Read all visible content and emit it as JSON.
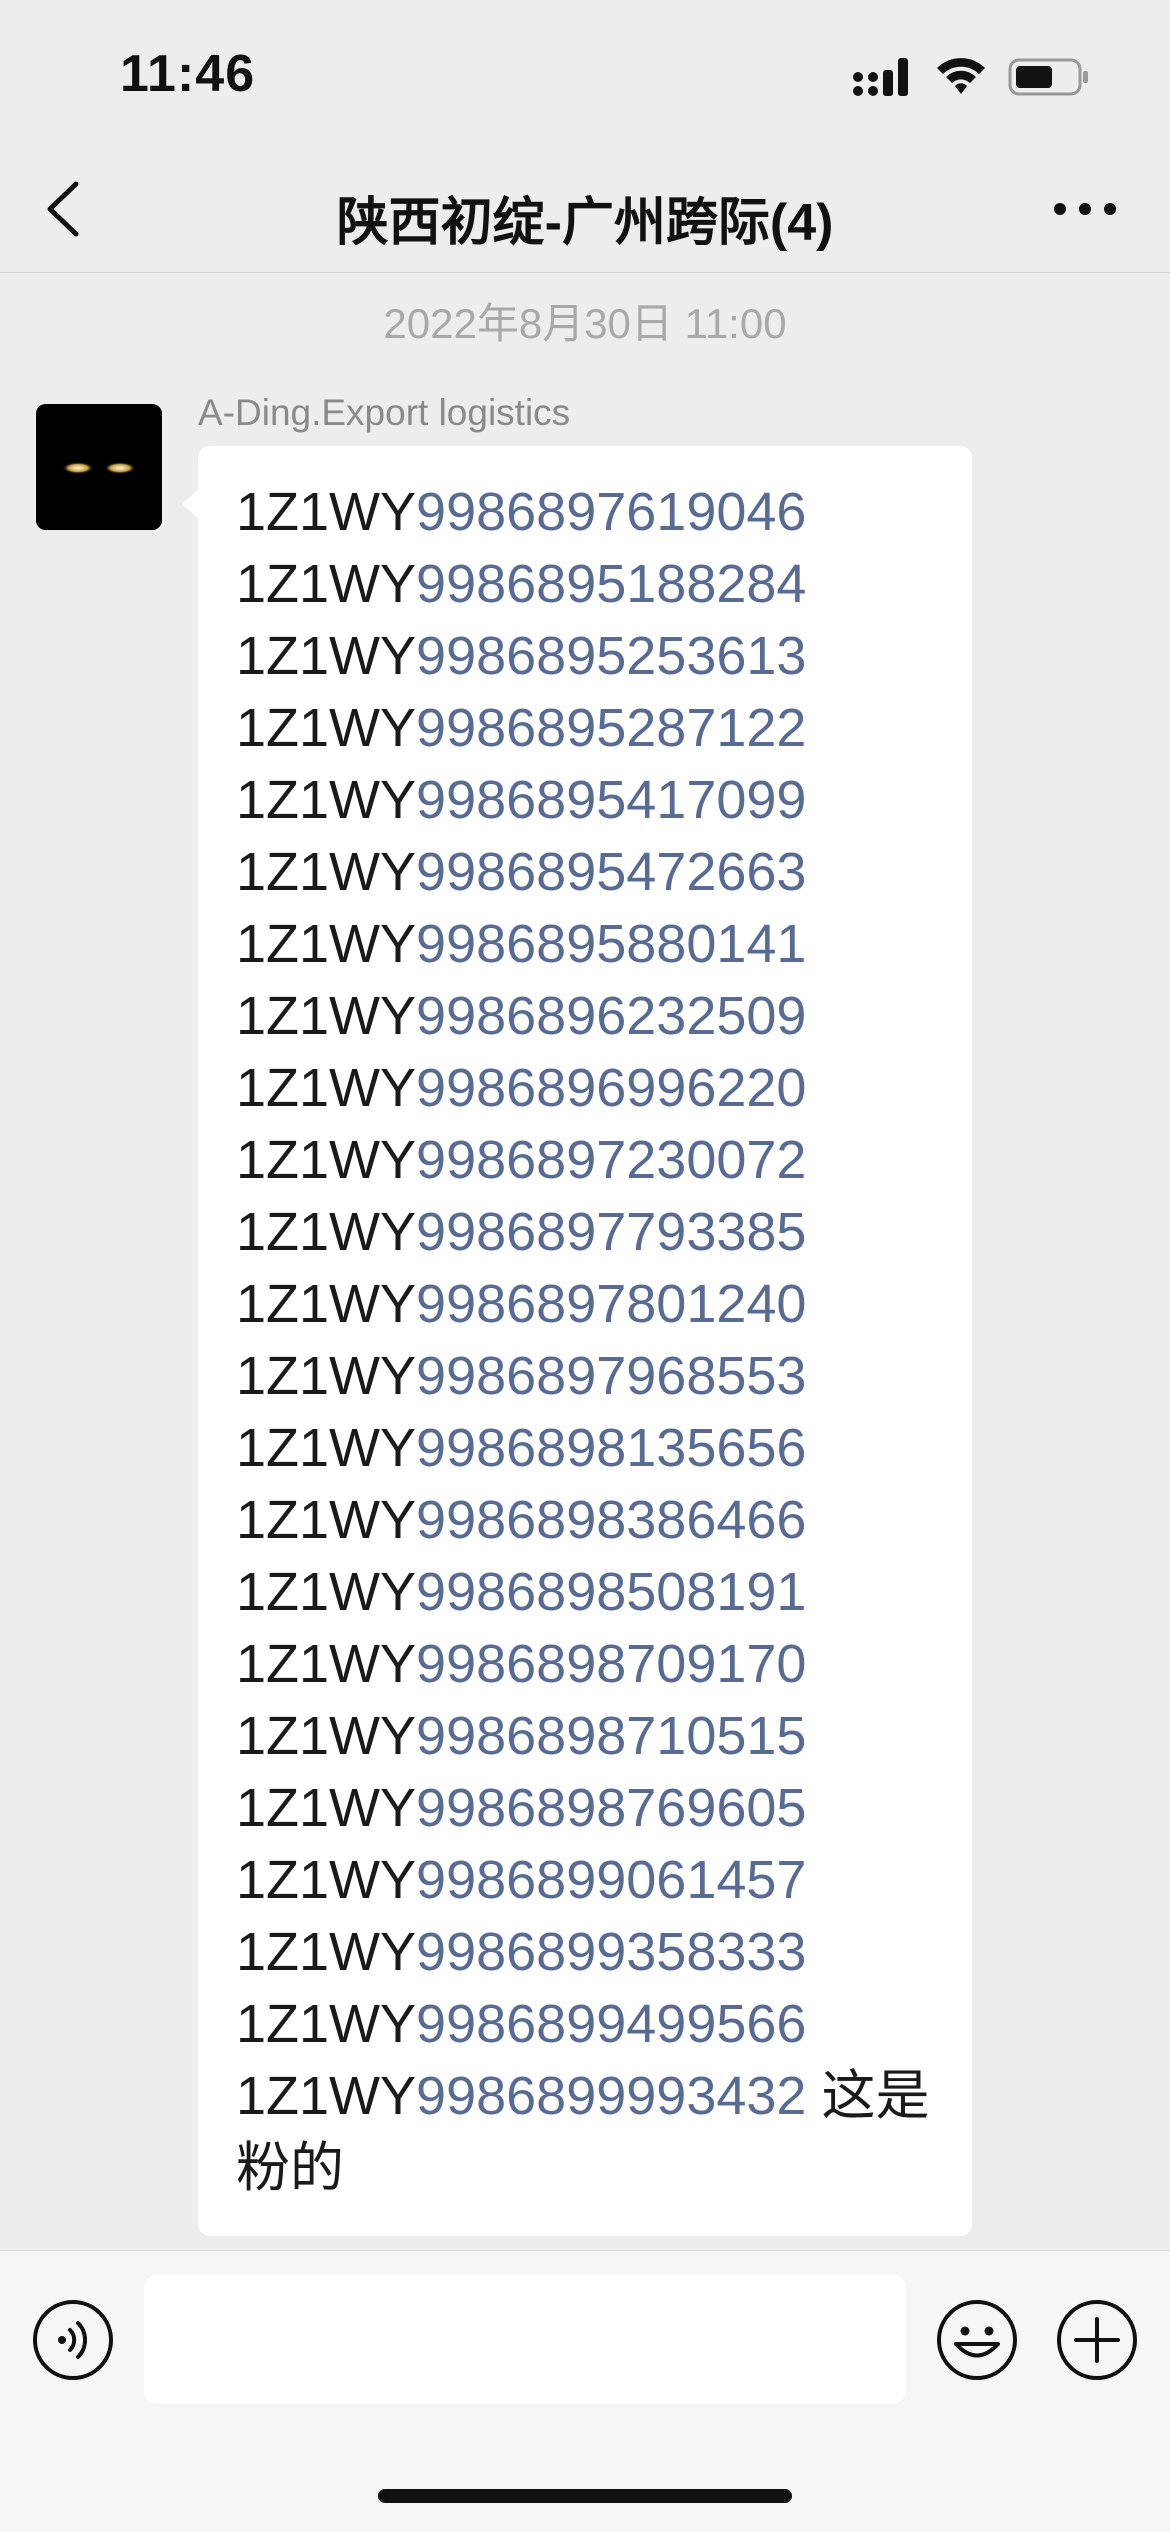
{
  "status_bar": {
    "time": "11:46",
    "icons": [
      "signal-icon",
      "wifi-icon",
      "battery-icon"
    ]
  },
  "nav": {
    "title": "陕西初绽-广州跨际(4)",
    "icons": [
      "back-icon",
      "more-icon"
    ]
  },
  "chat": {
    "timestamp": "2022年8月30日 11:00",
    "message": {
      "sender": "A-Ding.Export logistics",
      "lines": [
        {
          "prefix": "1Z1WY",
          "number": "9986897619046"
        },
        {
          "prefix": "1Z1WY",
          "number": "9986895188284"
        },
        {
          "prefix": "1Z1WY",
          "number": "9986895253613"
        },
        {
          "prefix": "1Z1WY",
          "number": "9986895287122"
        },
        {
          "prefix": "1Z1WY",
          "number": "9986895417099"
        },
        {
          "prefix": "1Z1WY",
          "number": "9986895472663"
        },
        {
          "prefix": "1Z1WY",
          "number": "9986895880141"
        },
        {
          "prefix": "1Z1WY",
          "number": "9986896232509"
        },
        {
          "prefix": "1Z1WY",
          "number": "9986896996220"
        },
        {
          "prefix": "1Z1WY",
          "number": "9986897230072"
        },
        {
          "prefix": "1Z1WY",
          "number": "9986897793385"
        },
        {
          "prefix": "1Z1WY",
          "number": "9986897801240"
        },
        {
          "prefix": "1Z1WY",
          "number": "9986897968553"
        },
        {
          "prefix": "1Z1WY",
          "number": "9986898135656"
        },
        {
          "prefix": "1Z1WY",
          "number": "9986898386466"
        },
        {
          "prefix": "1Z1WY",
          "number": "9986898508191"
        },
        {
          "prefix": "1Z1WY",
          "number": "9986898709170"
        },
        {
          "prefix": "1Z1WY",
          "number": "9986898710515"
        },
        {
          "prefix": " 1Z1WY",
          "number": "9986898769605"
        },
        {
          "prefix": "1Z1WY",
          "number": "9986899061457"
        },
        {
          "prefix": "1Z1WY",
          "number": "9986899358333"
        },
        {
          "prefix": "1Z1WY",
          "number": "9986899499566"
        },
        {
          "prefix": "1Z1WY",
          "number": "9986899993432",
          "suffix": " 这是粉的"
        }
      ]
    }
  },
  "input_bar": {
    "value": "",
    "icons": [
      "voice-icon",
      "emoji-icon",
      "plus-icon"
    ]
  },
  "colors": {
    "background": "#ededed",
    "bubble": "#ffffff",
    "link_number": "#576b95",
    "text": "#1a1a1a",
    "meta_text": "#a9a9a9"
  }
}
